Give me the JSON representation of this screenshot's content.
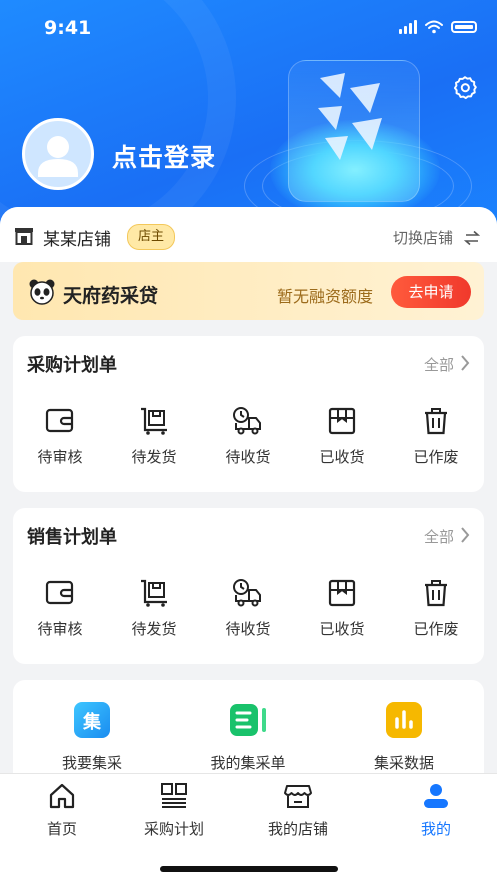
{
  "status_bar": {
    "time": "9:41"
  },
  "profile": {
    "login_text": "点击登录"
  },
  "store": {
    "name": "某某店铺",
    "role_badge": "店主",
    "switch_label": "切换店铺"
  },
  "banner": {
    "title": "天府药采贷",
    "subtitle": "暂无融资额度",
    "button": "去申请"
  },
  "purchase_plan": {
    "title": "采购计划单",
    "all_label": "全部",
    "items": [
      {
        "label": "待审核",
        "icon": "wallet-icon"
      },
      {
        "label": "待发货",
        "icon": "cart-box-icon"
      },
      {
        "label": "待收货",
        "icon": "truck-clock-icon"
      },
      {
        "label": "已收货",
        "icon": "box-icon"
      },
      {
        "label": "已作废",
        "icon": "trash-icon"
      }
    ]
  },
  "sales_plan": {
    "title": "销售计划单",
    "all_label": "全部",
    "items": [
      {
        "label": "待审核",
        "icon": "wallet-icon"
      },
      {
        "label": "待发货",
        "icon": "cart-box-icon"
      },
      {
        "label": "待收货",
        "icon": "truck-clock-icon"
      },
      {
        "label": "已收货",
        "icon": "box-icon"
      },
      {
        "label": "已作废",
        "icon": "trash-icon"
      }
    ]
  },
  "tools": [
    {
      "label": "我要集采",
      "icon": "group-buy-icon",
      "icon_text": "集",
      "color": "#1aa7f5"
    },
    {
      "label": "我的集采单",
      "icon": "order-list-icon",
      "color": "#19c26b"
    },
    {
      "label": "集采数据",
      "icon": "data-chart-icon",
      "color": "#f5b400"
    }
  ],
  "tabbar": [
    {
      "label": "首页",
      "icon": "home-icon"
    },
    {
      "label": "采购计划",
      "icon": "plan-icon"
    },
    {
      "label": "我的店铺",
      "icon": "store-icon"
    },
    {
      "label": "我的",
      "icon": "user-icon",
      "active": true
    }
  ],
  "colors": {
    "accent": "#1677ff",
    "apply": "#f0392c"
  }
}
